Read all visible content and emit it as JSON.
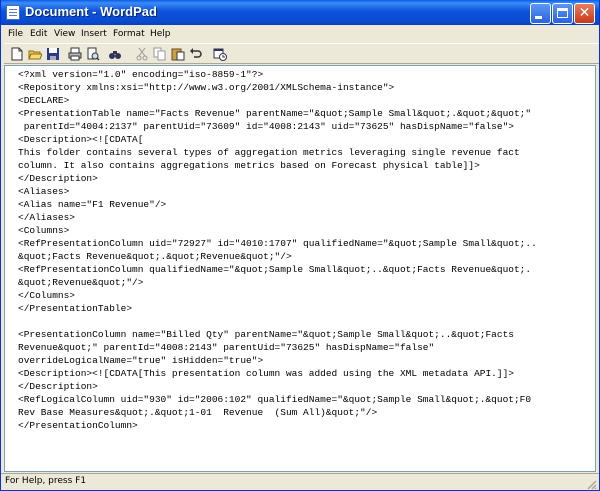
{
  "window": {
    "title": "Document - WordPad"
  },
  "menu": [
    "File",
    "Edit",
    "View",
    "Insert",
    "Format",
    "Help"
  ],
  "toolbar": {
    "icons": [
      "new-icon",
      "open-icon",
      "save-icon",
      "print-icon",
      "print-preview-icon",
      "find-icon",
      "cut-icon",
      "copy-icon",
      "paste-icon",
      "undo-icon",
      "insert-date-time-icon"
    ]
  },
  "document": {
    "lines": [
      "<?xml version=\"1.0\" encoding=\"iso-8859-1\"?>",
      "<Repository xmlns:xsi=\"http://www.w3.org/2001/XMLSchema-instance\">",
      "<DECLARE>",
      "<PresentationTable name=\"Facts Revenue\" parentName=\"&quot;Sample Small&quot;.&quot;&quot;\"",
      " parentId=\"4004:2137\" parentUid=\"73609\" id=\"4008:2143\" uid=\"73625\" hasDispName=\"false\">",
      "<Description><![CDATA[",
      "This folder contains several types of aggregation metrics leveraging single revenue fact",
      "column. It also contains aggregations metrics based on Forecast physical table]]>",
      "</Description>",
      "<Aliases>",
      "<Alias name=\"F1 Revenue\"/>",
      "</Aliases>",
      "<Columns>",
      "<RefPresentationColumn uid=\"72927\" id=\"4010:1707\" qualifiedName=\"&quot;Sample Small&quot;..",
      "&quot;Facts Revenue&quot;.&quot;Revenue&quot;\"/>",
      "<RefPresentationColumn qualifiedName=\"&quot;Sample Small&quot;..&quot;Facts Revenue&quot;.",
      "&quot;Revenue&quot;\"/>",
      "</Columns>",
      "</PresentationTable>",
      "",
      "<PresentationColumn name=\"Billed Qty\" parentName=\"&quot;Sample Small&quot;..&quot;Facts",
      "Revenue&quot;\" parentId=\"4008:2143\" parentUid=\"73625\" hasDispName=\"false\"",
      "overrideLogicalName=\"true\" isHidden=\"true\">",
      "<Description><![CDATA[This presentation column was added using the XML metadata API.]]>",
      "</Description>",
      "<RefLogicalColumn uid=\"930\" id=\"2006:102\" qualifiedName=\"&quot;Sample Small&quot;.&quot;F0",
      "Rev Base Measures&quot;.&quot;1-01  Revenue  (Sum All)&quot;\"/>",
      "</PresentationColumn>"
    ]
  },
  "status": {
    "text": "For Help, press F1"
  }
}
